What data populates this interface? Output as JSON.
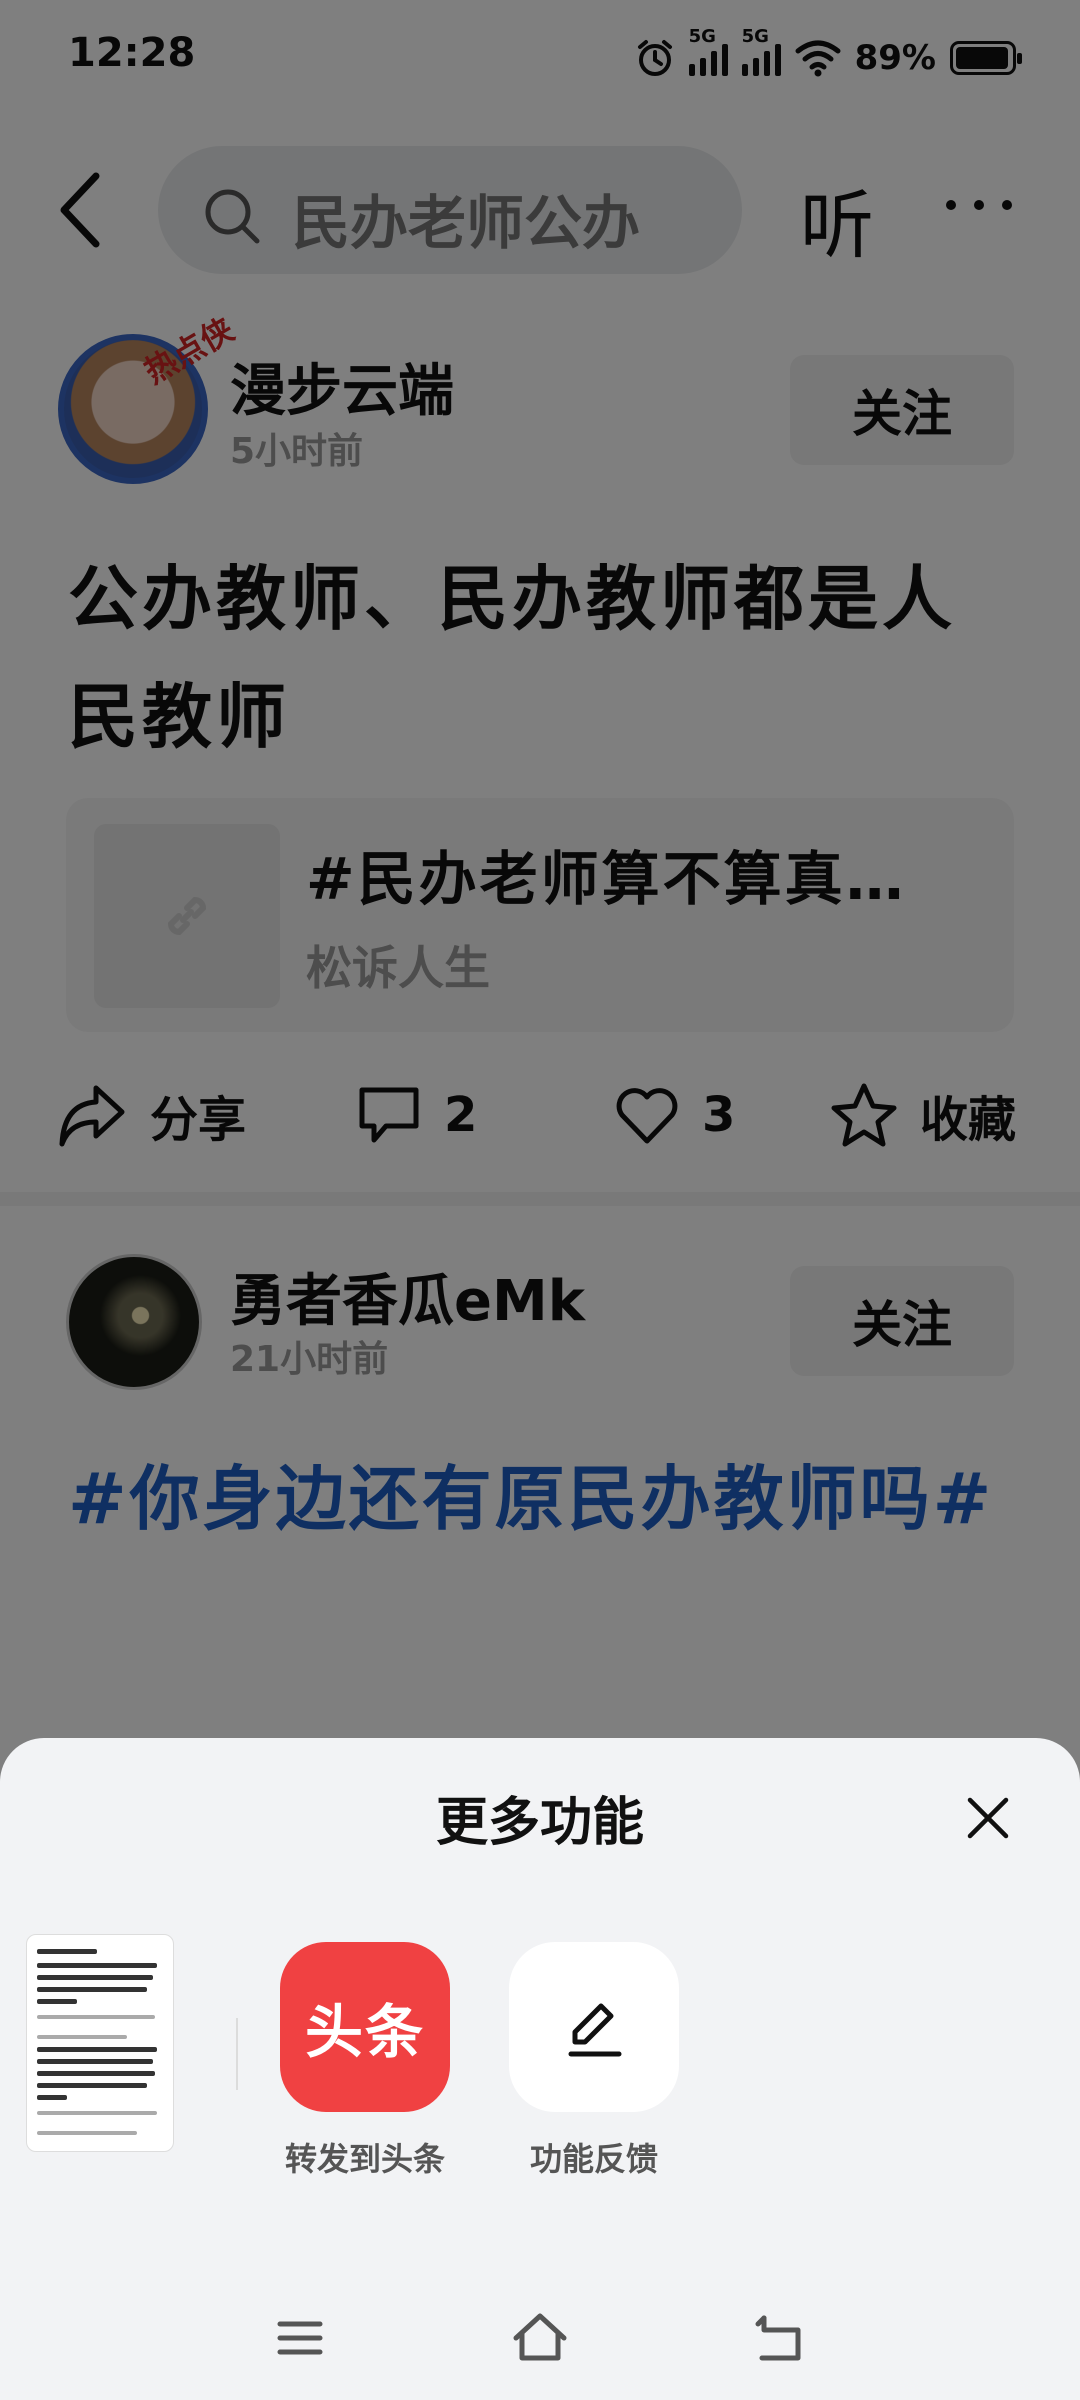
{
  "status_bar": {
    "time": "12:28",
    "signal1_label": "5G",
    "signal2_label": "5G",
    "battery": "89%",
    "icons": [
      "alarm-icon",
      "signal-icon",
      "signal-icon",
      "wifi-icon",
      "battery-icon"
    ]
  },
  "top_nav": {
    "search_text": "民办老师公办",
    "listen_label": "听"
  },
  "posts": [
    {
      "author": "漫步云端",
      "avatar_badge": "热点侠",
      "time": "5小时前",
      "follow_label": "关注",
      "title": "公办教师、民办教师都是人民教师",
      "link_title": "#民办老师算不算真…",
      "link_source": "松诉人生",
      "actions": {
        "share": "分享",
        "comments": "2",
        "likes": "3",
        "favorite": "收藏"
      }
    },
    {
      "author": "勇者香瓜eMk",
      "time": "21小时前",
      "follow_label": "关注",
      "tag_text": "#你身边还有原民办教师吗#"
    }
  ],
  "sheet": {
    "title": "更多功能",
    "options": [
      {
        "icon_text": "头条",
        "label": "转发到头条"
      },
      {
        "icon_text": "",
        "label": "功能反馈"
      }
    ]
  },
  "colors": {
    "overlay": "#000000",
    "toutiao_red": "#f04142",
    "hashtag_blue": "#1e5fc4"
  }
}
